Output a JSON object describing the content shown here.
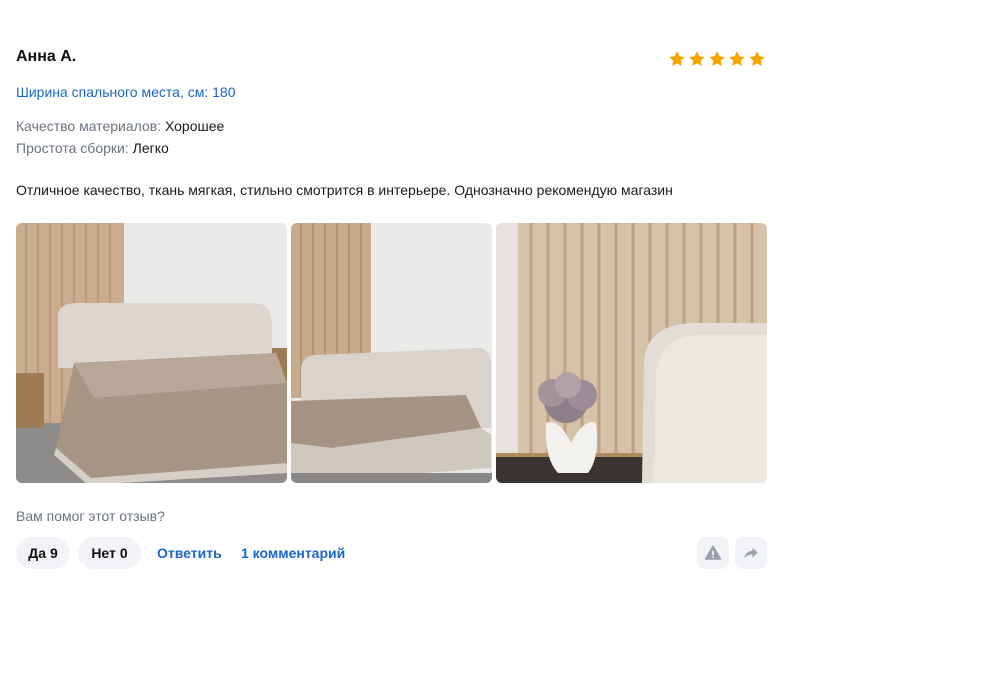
{
  "review": {
    "author": "Анна А.",
    "rating": 5,
    "max_rating": 5,
    "size_label": "Ширина спального места, см: 180",
    "params": [
      {
        "label": "Качество материалов:",
        "value": "Хорошее"
      },
      {
        "label": "Простота сборки:",
        "value": "Легко"
      }
    ],
    "text": "Отличное качество, ткань мягкая, стильно смотрится в интерьере. Однозначно рекомендую магазин",
    "photos_count": 3,
    "helpful_question": "Вам помог этот отзыв?",
    "yes_label": "Да",
    "yes_count": "9",
    "no_label": "Нет",
    "no_count": "0",
    "reply_label": "Ответить",
    "comments_label": "1 комментарий"
  },
  "icons": {
    "star": "star-icon",
    "report": "warning-icon",
    "share": "share-arrow-icon"
  },
  "colors": {
    "star": "#f7a600",
    "link": "#1a66cc",
    "muted_text": "#6b7480",
    "button_bg": "#f2f3f7",
    "icon_gray": "#9aa1ad"
  }
}
